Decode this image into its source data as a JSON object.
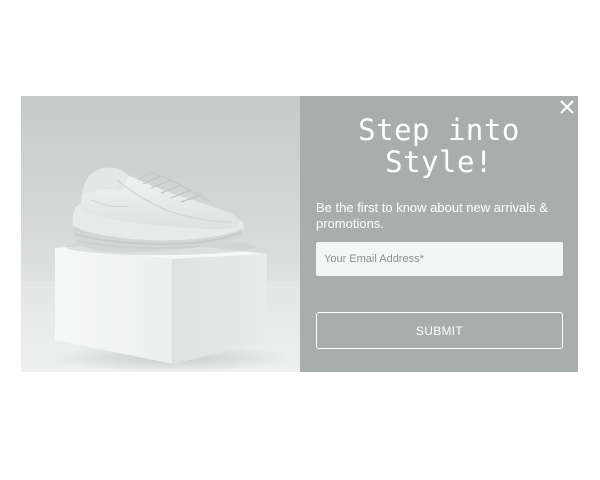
{
  "popup": {
    "headline": "Step into\nStyle!",
    "subtext": "Be the first to know about new arrivals & promotions.",
    "email_placeholder": "Your Email Address*",
    "submit_label": "SUBMIT"
  },
  "icons": {
    "close": "close-icon"
  },
  "colors": {
    "form_panel_bg": "#a9aeac",
    "text": "#ffffff",
    "input_bg": "#f4f6f5"
  }
}
